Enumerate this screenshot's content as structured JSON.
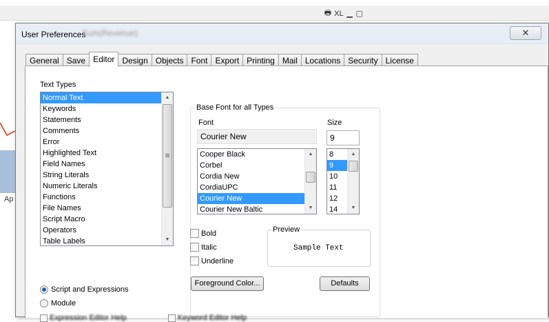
{
  "background": {
    "toolbar_icons": [
      "XL"
    ],
    "chart_label": "Ap"
  },
  "dialog": {
    "title": "User Preferences",
    "title_blurred": "Sum(Revenue)",
    "close_glyph": "✕"
  },
  "tabs": [
    {
      "label": "General"
    },
    {
      "label": "Save"
    },
    {
      "label": "Editor",
      "active": true
    },
    {
      "label": "Design"
    },
    {
      "label": "Objects"
    },
    {
      "label": "Font"
    },
    {
      "label": "Export"
    },
    {
      "label": "Printing"
    },
    {
      "label": "Mail"
    },
    {
      "label": "Locations"
    },
    {
      "label": "Security"
    },
    {
      "label": "License"
    }
  ],
  "text_types": {
    "label": "Text Types",
    "items": [
      "Normal Text",
      "Keywords",
      "Statements",
      "Comments",
      "Error",
      "Highlighted Text",
      "Field Names",
      "String Literals",
      "Numeric Literals",
      "Functions",
      "File Names",
      "Script Macro",
      "Operators",
      "Table Labels"
    ],
    "selected": "Normal Text"
  },
  "base_font": {
    "group_label": "Base Font for all Types",
    "font_label": "Font",
    "font_value": "Courier New",
    "size_label": "Size",
    "size_value": "9",
    "font_list": [
      "Cooper Black",
      "Corbel",
      "Cordia New",
      "CordiaUPC",
      "Courier New",
      "Courier New Baltic"
    ],
    "font_selected": "Courier New",
    "size_list": [
      "8",
      "9",
      "10",
      "11",
      "12",
      "14"
    ],
    "size_selected": "9"
  },
  "style": {
    "bold": "Bold",
    "italic": "Italic",
    "underline": "Underline"
  },
  "preview": {
    "label": "Preview",
    "sample": "Sample Text"
  },
  "buttons": {
    "foreground": "Foreground Color...",
    "defaults": "Defaults"
  },
  "mode": {
    "script": "Script and Expressions",
    "module": "Module",
    "selected": "script"
  },
  "partial_options": [
    "Expression Editor Help",
    "Keyword Editor Help"
  ],
  "colors": {
    "selection": "#3399ff",
    "dialog_bg": "#f0f0f0",
    "titlebar": "#e8eef6"
  }
}
